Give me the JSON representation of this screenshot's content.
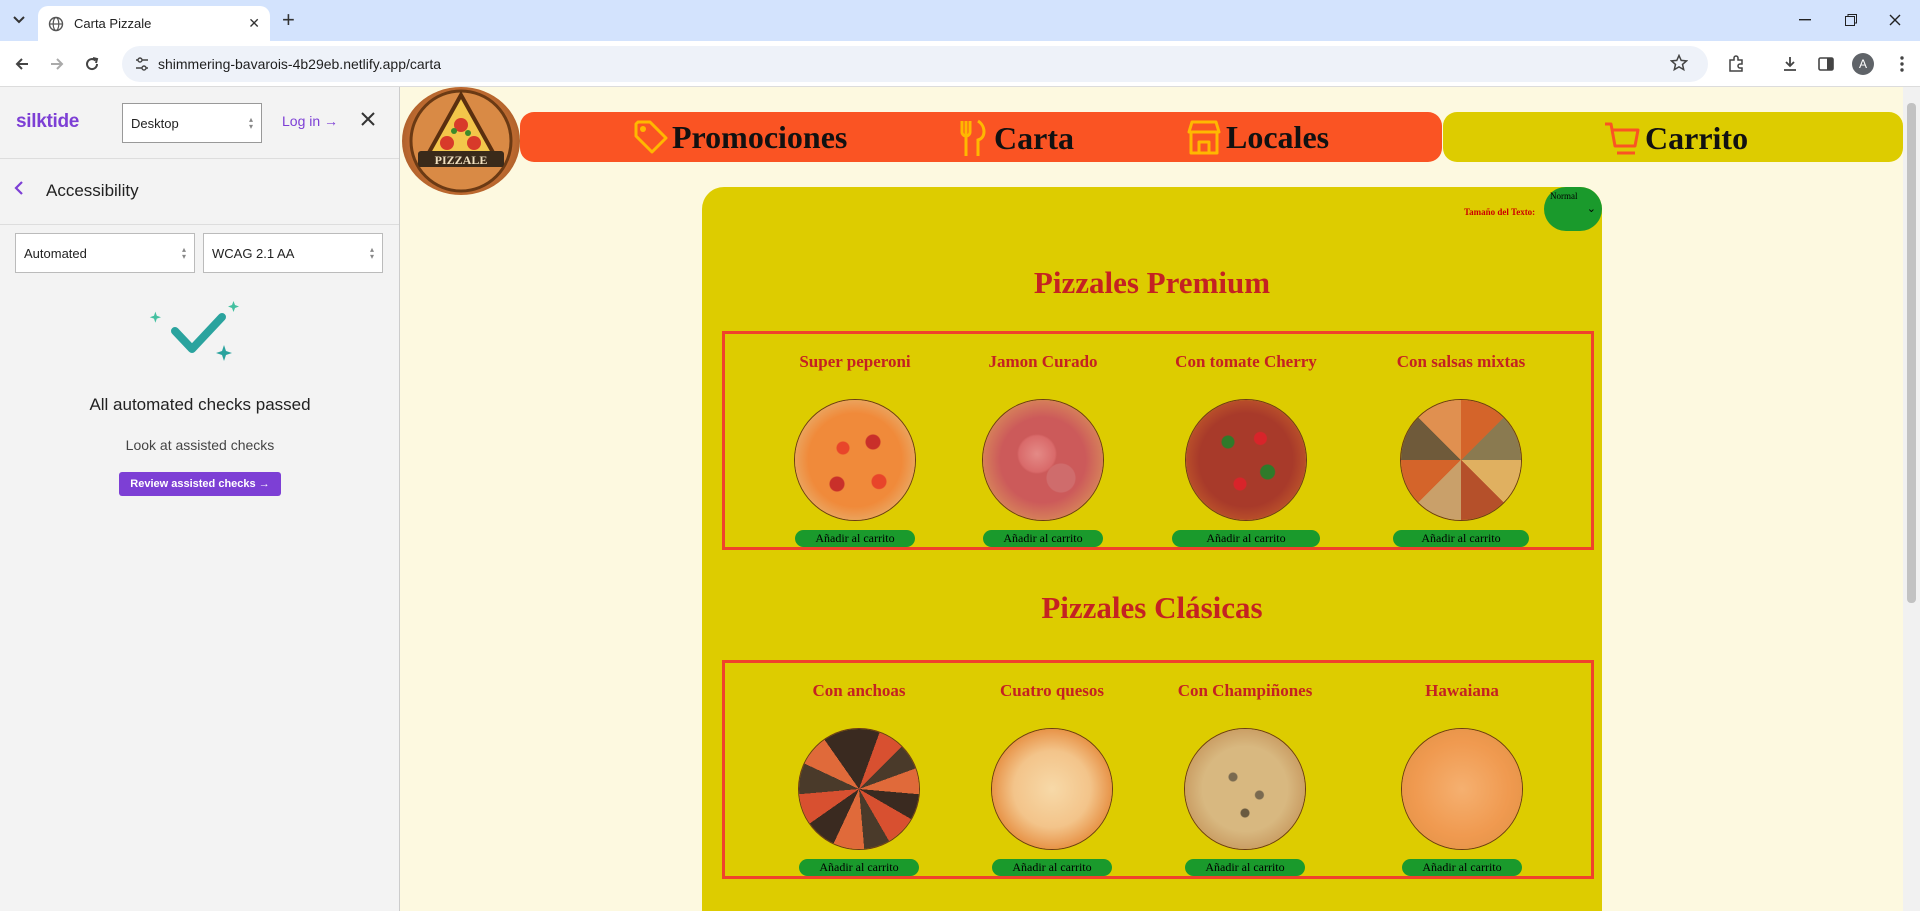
{
  "browser": {
    "tab_title": "Carta Pizzale",
    "url": "shimmering-bavarois-4b29eb.netlify.app/carta",
    "avatar_letter": "A"
  },
  "silktide": {
    "brand": "silktide",
    "device": "Desktop",
    "login": "Log in",
    "section_title": "Accessibility",
    "mode": "Automated",
    "standard": "WCAG 2.1 AA",
    "passed_text": "All automated checks passed",
    "assisted_link": "Look at assisted checks",
    "review_button": "Review assisted checks"
  },
  "site": {
    "logo_text": "PIZZALE",
    "nav": {
      "promos": "Promociones",
      "menu": "Carta",
      "stores": "Locales",
      "cart": "Carrito"
    },
    "text_size_label": "Tamaño del Texto:",
    "text_size_value": "Normal",
    "sections": [
      {
        "title": "Pizzales Premium",
        "items": [
          {
            "name": "Super peperoni",
            "button": "Añadir al carrito"
          },
          {
            "name": "Jamon Curado",
            "button": "Añadir al carrito"
          },
          {
            "name": "Con tomate Cherry",
            "button": "Añadir al carrito"
          },
          {
            "name": "Con salsas mixtas",
            "button": "Añadir al carrito"
          }
        ]
      },
      {
        "title": "Pizzales Clásicas",
        "items": [
          {
            "name": "Con anchoas",
            "button": "Añadir al carrito"
          },
          {
            "name": "Cuatro quesos",
            "button": "Añadir al carrito"
          },
          {
            "name": "Con Champiñones",
            "button": "Añadir al carrito"
          },
          {
            "name": "Hawaiana",
            "button": "Añadir al carrito"
          }
        ]
      }
    ]
  },
  "colors": {
    "nav_red": "#fa5423",
    "content_yellow": "#ddcc00",
    "title_red": "#c42222",
    "button_green": "#1a9a2c",
    "silktide_purple": "#7d3fd5"
  }
}
